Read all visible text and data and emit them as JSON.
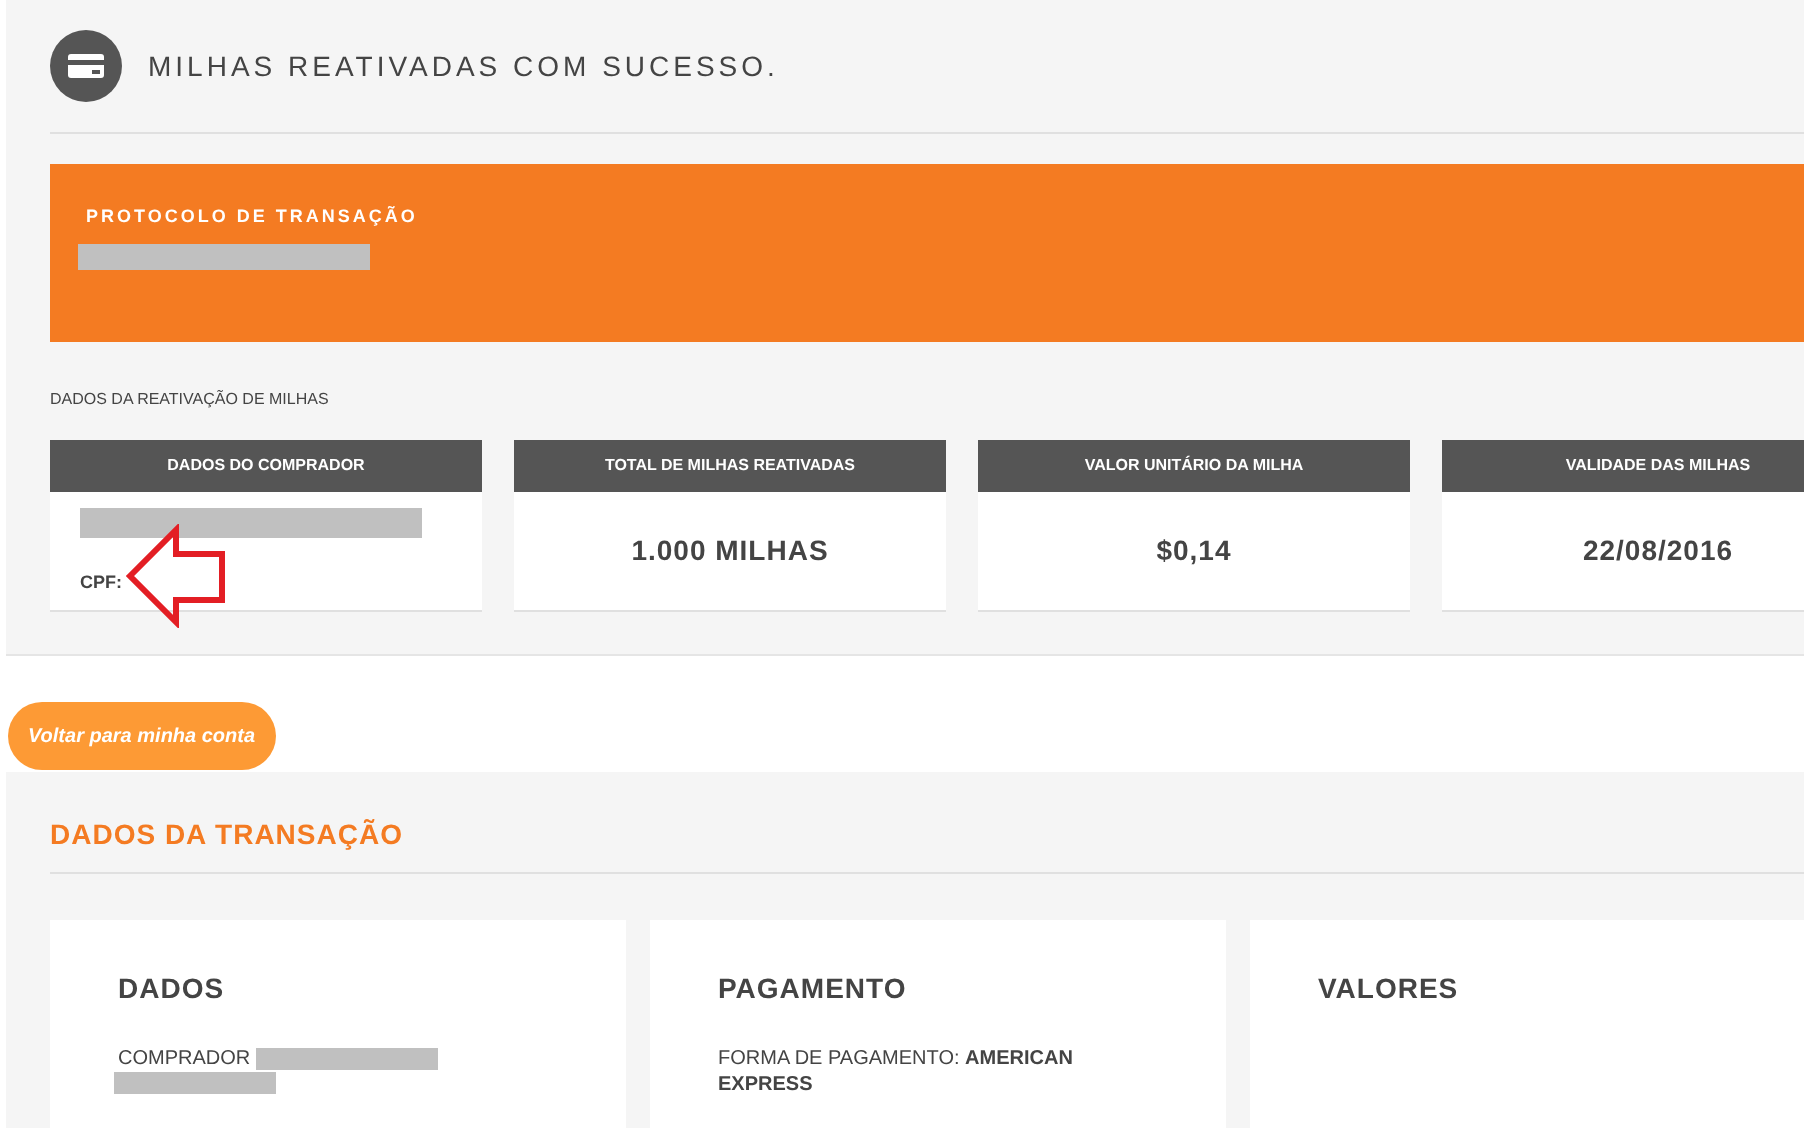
{
  "header": {
    "title": "MILHAS REATIVADAS COM SUCESSO."
  },
  "protocol": {
    "label": "PROTOCOLO DE TRANSAÇÃO"
  },
  "reactivation": {
    "label": "DADOS DA REATIVAÇÃO DE MILHAS",
    "cards": [
      {
        "kind": "buyer",
        "header": "DADOS DO COMPRADOR",
        "value": "CPF:"
      },
      {
        "kind": "value",
        "header": "TOTAL DE MILHAS REATIVADAS",
        "value": "1.000 MILHAS"
      },
      {
        "kind": "value",
        "header": "VALOR UNITÁRIO DA MILHA",
        "value": "$0,14"
      },
      {
        "kind": "value",
        "header": "VALIDADE DAS MILHAS",
        "value": "22/08/2016"
      }
    ]
  },
  "back_button": {
    "label": "Voltar para minha conta"
  },
  "transaction": {
    "title": "DADOS DA TRANSAÇÃO",
    "cards": [
      {
        "kind": "buyer",
        "title": "DADOS",
        "text": "COMPRADOR"
      },
      {
        "kind": "text",
        "title": "PAGAMENTO",
        "text": "FORMA DE PAGAMENTO: **AMERICAN EXPRESS**"
      },
      {
        "kind": "text",
        "title": "VALORES"
      }
    ]
  }
}
